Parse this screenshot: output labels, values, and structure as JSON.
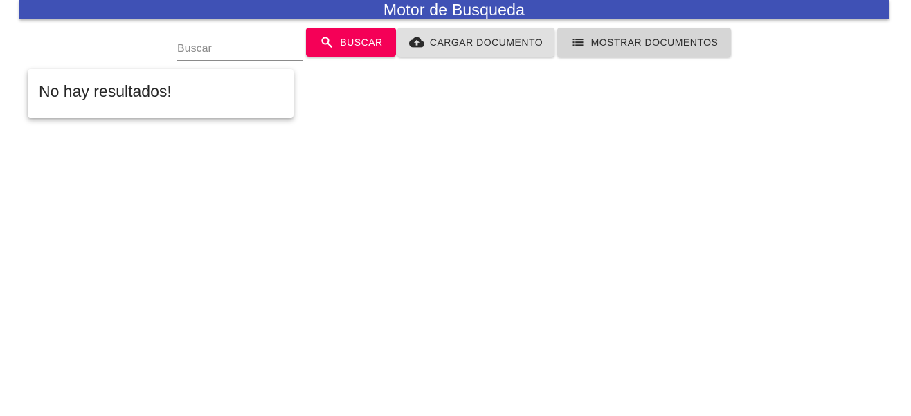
{
  "header": {
    "title": "Motor de Busqueda",
    "color": "#3f51b5"
  },
  "search": {
    "placeholder": "Buscar",
    "value": ""
  },
  "toolbar": {
    "search_label": "BUSCAR",
    "search_icon": "search-icon",
    "search_color": "#f50057",
    "upload_label": "CARGAR DOCUMENTO",
    "upload_icon": "cloud-upload-icon",
    "list_label": "MOSTRAR DOCUMENTOS",
    "list_icon": "list-icon"
  },
  "results": {
    "message": "No hay resultados!"
  }
}
